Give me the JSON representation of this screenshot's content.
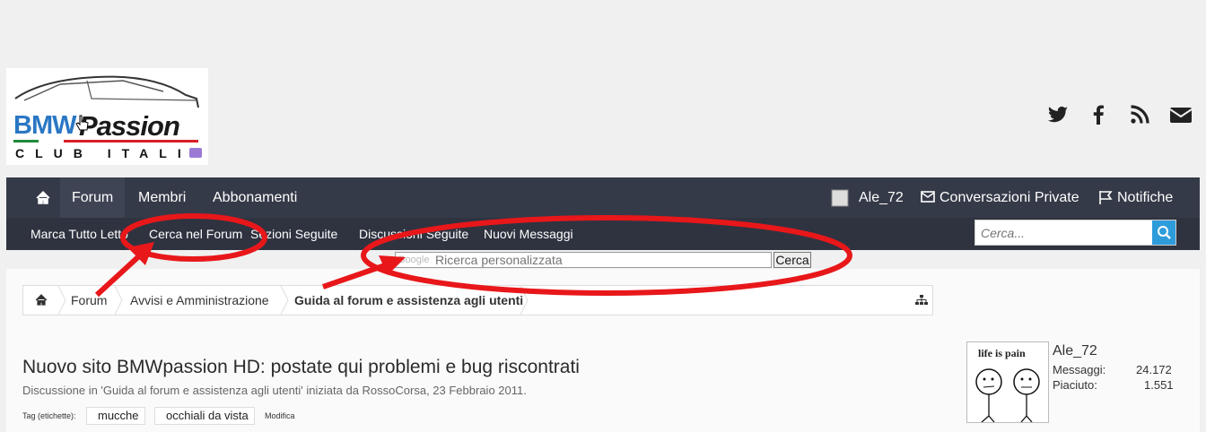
{
  "logo": {
    "line1": "BMW",
    "line2": "Passion",
    "sub": "CLUB ITALI"
  },
  "social": [
    "twitter-icon",
    "facebook-icon",
    "rss-icon",
    "mail-icon"
  ],
  "nav": {
    "tabs": [
      "Forum",
      "Membri",
      "Abbonamenti"
    ],
    "user": "Ale_72",
    "messages": "Conversazioni Private",
    "alerts": "Notifiche",
    "sub": [
      "Marca Tutto Letto",
      "Cerca nel Forum",
      "Sezioni Seguite",
      "Discussioni Seguite",
      "Nuovi Messaggi"
    ],
    "search_placeholder": "Cerca..."
  },
  "gsearch": {
    "logo": "Google",
    "placeholder": "Ricerca personalizzata",
    "button": "Cerca"
  },
  "breadcrumb": [
    "Forum",
    "Avvisi e Amministrazione",
    "Guida al forum e assistenza agli utenti"
  ],
  "thread": {
    "title": "Nuovo sito BMWpassion HD: postate qui problemi e bug riscontrati",
    "meta": "Discussione in 'Guida al forum e assistenza agli utenti' iniziata da RossoCorsa, 23 Febbraio 2011.",
    "tag_label": "Tag (etichette):",
    "tags": [
      "mucche",
      "occhiali da vista"
    ],
    "edit": "Modifica"
  },
  "user_card": {
    "avatar_text": "life is pain",
    "name": "Ale_72",
    "messages_label": "Messaggi:",
    "messages_value": "24.172",
    "likes_label": "Piaciuto:",
    "likes_value": "1.551"
  },
  "colors": {
    "nav_bg": "#353a48",
    "search_btn": "#2e9cdb",
    "annotation": "#e8171a"
  }
}
